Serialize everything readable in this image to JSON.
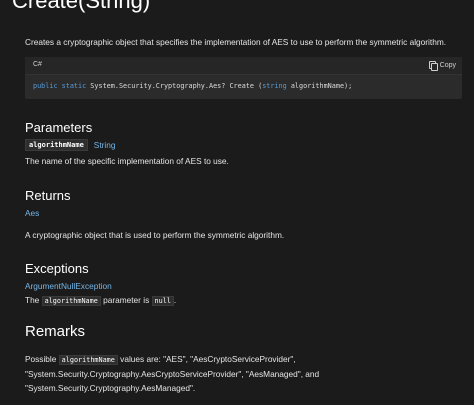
{
  "page": {
    "title": "Create(String)",
    "intro": "Creates a cryptographic object that specifies the implementation of AES to use to perform the symmetric algorithm."
  },
  "code": {
    "language": "C#",
    "copy_label": "Copy",
    "kw_public": "public",
    "kw_static": "static",
    "signature_mid": " System.Security.Cryptography.Aes? Create (",
    "kw_string": "string",
    "signature_end": " algorithmName);"
  },
  "parameters": {
    "heading": "Parameters",
    "name": "algorithmName",
    "type": "String",
    "description": "The name of the specific implementation of AES to use."
  },
  "returns": {
    "heading": "Returns",
    "type": "Aes",
    "description": "A cryptographic object that is used to perform the symmetric algorithm."
  },
  "exceptions": {
    "heading": "Exceptions",
    "type": "ArgumentNullException",
    "desc_pre": "The ",
    "desc_code": "algorithmName",
    "desc_mid": " parameter is ",
    "desc_null": "null",
    "desc_end": "."
  },
  "remarks": {
    "heading": "Remarks",
    "line1_pre": "Possible ",
    "line1_code": "algorithmName",
    "line1_post": " values are: \"AES\", \"AesCryptoServiceProvider\",",
    "line2": "\"System.Security.Cryptography.AesCryptoServiceProvider\", \"AesManaged\", and",
    "line3": "\"System.Security.Cryptography.AesManaged\"."
  }
}
